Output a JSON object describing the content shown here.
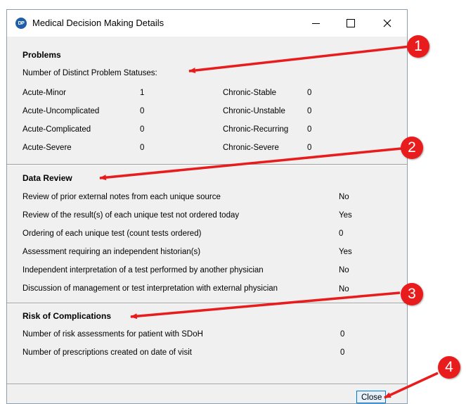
{
  "window": {
    "title": "Medical Decision Making Details",
    "app_icon_text": "DP"
  },
  "problems": {
    "title": "Problems",
    "subtitle": "Number of Distinct Problem Statuses:",
    "left": [
      {
        "label": "Acute-Minor",
        "value": "1"
      },
      {
        "label": "Acute-Uncomplicated",
        "value": "0"
      },
      {
        "label": "Acute-Complicated",
        "value": "0"
      },
      {
        "label": "Acute-Severe",
        "value": "0"
      }
    ],
    "right": [
      {
        "label": "Chronic-Stable",
        "value": "0"
      },
      {
        "label": "Chronic-Unstable",
        "value": "0"
      },
      {
        "label": "Chronic-Recurring",
        "value": "0"
      },
      {
        "label": "Chronic-Severe",
        "value": "0"
      }
    ]
  },
  "data_review": {
    "title": "Data Review",
    "rows": [
      {
        "label": "Review of prior external notes from each unique source",
        "value": "No"
      },
      {
        "label": "Review of the result(s) of each unique test not ordered today",
        "value": "Yes"
      },
      {
        "label": "Ordering of each unique test (count tests ordered)",
        "value": "0"
      },
      {
        "label": "Assessment requiring an independent historian(s)",
        "value": "Yes"
      },
      {
        "label": "Independent interpretation of a test performed by another physician",
        "value": "No"
      },
      {
        "label": "Discussion of management or test interpretation with external physician",
        "value": "No"
      }
    ]
  },
  "risk": {
    "title": "Risk of Complications",
    "rows": [
      {
        "label": "Number of risk assessments for patient with SDoH",
        "value": "0"
      },
      {
        "label": "Number of prescriptions created on date of visit",
        "value": "0"
      }
    ]
  },
  "buttons": {
    "close": "Close"
  },
  "annotations": [
    "1",
    "2",
    "3",
    "4"
  ],
  "colors": {
    "annotation": "#e81c1c",
    "focus_border": "#0078d7"
  }
}
